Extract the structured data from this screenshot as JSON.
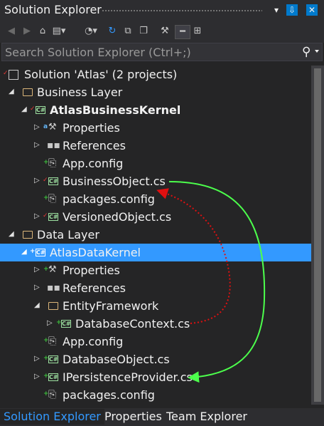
{
  "window": {
    "title": "Solution Explorer",
    "menu_glyph": "▾",
    "pin_glyph": "⇩",
    "close_glyph": "✕"
  },
  "toolbar": {
    "icons": [
      "back-icon",
      "forward-icon",
      "home-icon",
      "solutions-views-icon",
      "pending-changes-filter-icon",
      "sync-icon",
      "collapse-all-icon",
      "show-all-files-icon",
      "properties-icon",
      "preview-icon",
      "class-view-icon"
    ]
  },
  "search": {
    "placeholder": "Search Solution Explorer (Ctrl+;)",
    "value": ""
  },
  "tree": {
    "items": [
      {
        "label": "Solution 'Atlas' (2 projects)",
        "icon": "solution-icon",
        "status": "checked-out",
        "expanded": null
      },
      {
        "label": "Business Layer",
        "icon": "folder-icon",
        "status": "",
        "expanded": true
      },
      {
        "label": "AtlasBusinessKernel",
        "icon": "csharp-project-icon",
        "status": "checked-out",
        "expanded": true,
        "bold": true
      },
      {
        "label": "Properties",
        "icon": "wrench-icon",
        "status": "locked",
        "expanded": false
      },
      {
        "label": "References",
        "icon": "references-icon",
        "status": "",
        "expanded": false
      },
      {
        "label": "App.config",
        "icon": "config-file-icon",
        "status": "pending-add",
        "expanded": null
      },
      {
        "label": "BusinessObject.cs",
        "icon": "csharp-file-icon",
        "status": "checked-out",
        "expanded": false
      },
      {
        "label": "packages.config",
        "icon": "config-file-icon",
        "status": "pending-add",
        "expanded": null
      },
      {
        "label": "VersionedObject.cs",
        "icon": "csharp-file-icon",
        "status": "checked-out",
        "expanded": false
      },
      {
        "label": "Data Layer",
        "icon": "folder-icon",
        "status": "",
        "expanded": true
      },
      {
        "label": "AtlasDataKernel",
        "icon": "csharp-project-icon",
        "status": "pending-add",
        "expanded": true,
        "selected": true
      },
      {
        "label": "Properties",
        "icon": "wrench-icon",
        "status": "pending-add",
        "expanded": false
      },
      {
        "label": "References",
        "icon": "references-icon",
        "status": "",
        "expanded": false
      },
      {
        "label": "EntityFramework",
        "icon": "folder-icon",
        "status": "",
        "expanded": true
      },
      {
        "label": "DatabaseContext.cs",
        "icon": "csharp-file-icon",
        "status": "pending-add",
        "expanded": false
      },
      {
        "label": "App.config",
        "icon": "config-file-icon",
        "status": "pending-add",
        "expanded": null
      },
      {
        "label": "DatabaseObject.cs",
        "icon": "csharp-file-icon",
        "status": "pending-add",
        "expanded": false
      },
      {
        "label": "IPersistenceProvider.cs",
        "icon": "csharp-file-icon",
        "status": "pending-add",
        "expanded": false
      },
      {
        "label": "packages.config",
        "icon": "config-file-icon",
        "status": "pending-add",
        "expanded": null
      }
    ]
  },
  "bottom_tabs": [
    {
      "label": "Solution Explorer",
      "active": true
    },
    {
      "label": "Properties",
      "active": false
    },
    {
      "label": "Team Explorer",
      "active": false
    }
  ],
  "annotations": {
    "green_arrow_color": "#4cff4c",
    "red_arrow_color": "#e01010"
  },
  "colors": {
    "background": "#252526",
    "selection": "#3399ff",
    "accent": "#007acc"
  }
}
